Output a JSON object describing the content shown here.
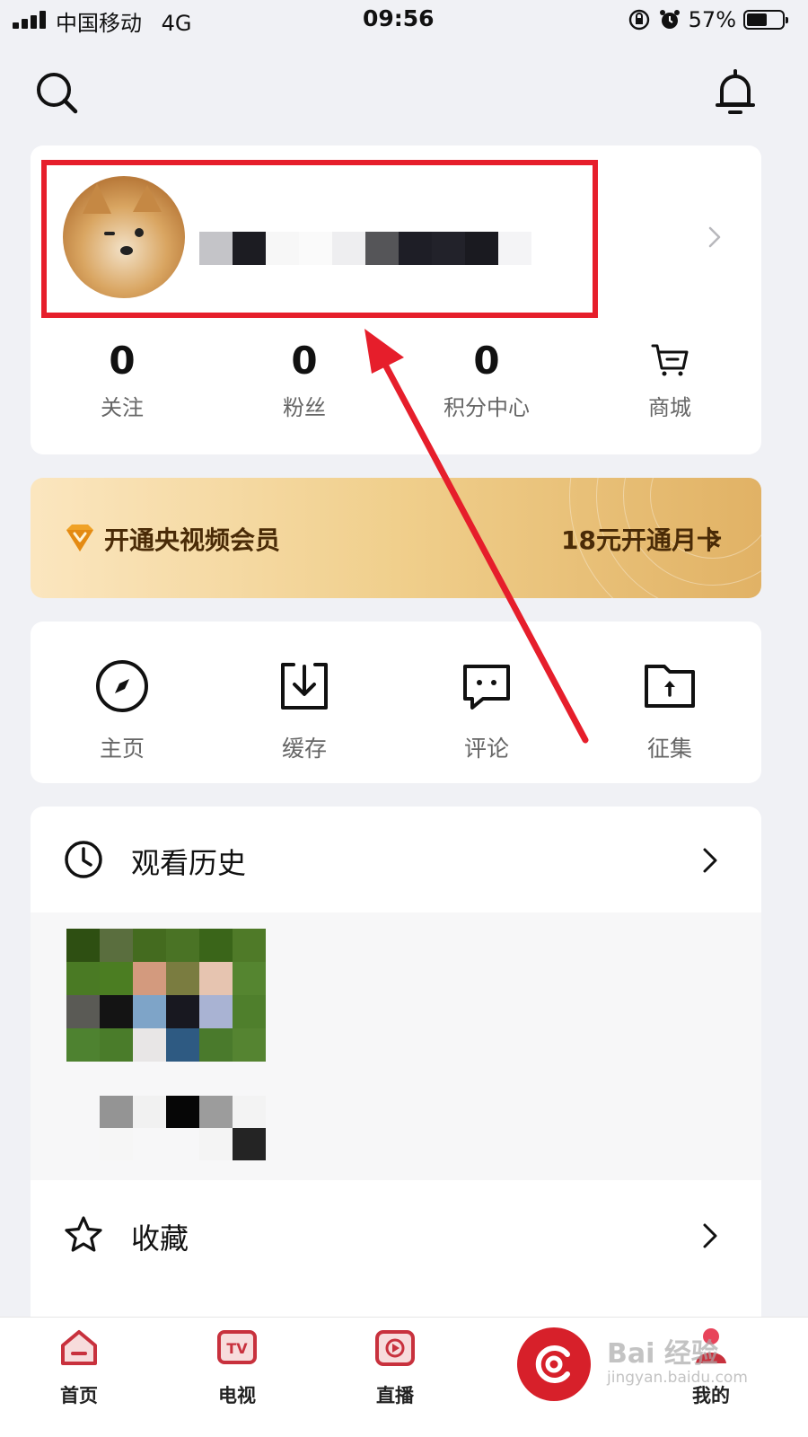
{
  "status_bar": {
    "carrier": "中国移动",
    "network": "4G",
    "time": "09:56",
    "battery_percent_text": "57%",
    "battery_level": 0.57
  },
  "profile": {
    "stats": [
      {
        "value": "0",
        "label": "关注"
      },
      {
        "value": "0",
        "label": "粉丝"
      },
      {
        "value": "0",
        "label": "积分中心"
      }
    ],
    "shop_label": "商城"
  },
  "vip_banner": {
    "title": "开通央视频会员",
    "action": "18元开通月卡"
  },
  "quick_actions": [
    {
      "label": "主页",
      "icon": "compass-icon"
    },
    {
      "label": "缓存",
      "icon": "download-icon"
    },
    {
      "label": "评论",
      "icon": "comment-icon"
    },
    {
      "label": "征集",
      "icon": "folder-upload-icon"
    }
  ],
  "history": {
    "title": "观看历史"
  },
  "favorites": {
    "title": "收藏"
  },
  "tabs": [
    {
      "label": "首页",
      "icon": "home-icon"
    },
    {
      "label": "电视",
      "icon": "tv-icon"
    },
    {
      "label": "直播",
      "icon": "live-icon"
    },
    {
      "label": "",
      "icon": "center-logo-icon"
    },
    {
      "label": "我的",
      "icon": "profile-icon"
    }
  ],
  "watermark": {
    "brand": "Bai 经验",
    "url": "jingyan.baidu.com"
  },
  "colors": {
    "accent_red": "#e61e2b",
    "vip_text": "#4a2b07",
    "tab_icon": "#c8313d"
  }
}
